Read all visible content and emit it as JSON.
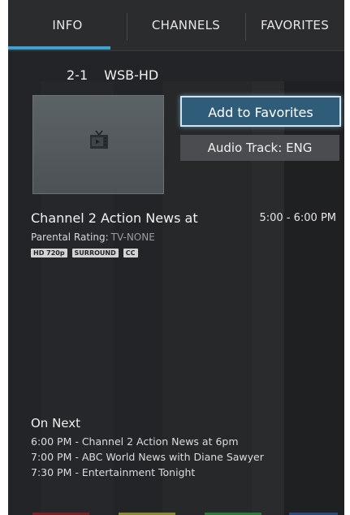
{
  "tabs": [
    {
      "label": "INFO",
      "active": true
    },
    {
      "label": "CHANNELS",
      "active": false
    },
    {
      "label": "FAVORITES",
      "active": false
    }
  ],
  "accent_color": "#3aa3d6",
  "channel": {
    "number": "2-1",
    "name": "WSB-HD",
    "thumbnail_icon": "tv-icon"
  },
  "actions": {
    "favorites_label": "Add to Favorites",
    "audio_label": "Audio Track: ENG"
  },
  "program": {
    "title": "Channel 2 Action News at",
    "time": "5:00 - 6:00 PM",
    "rating_label": "Parental Rating:",
    "rating_value": "TV-NONE",
    "badges": [
      "HD 720p",
      "SURROUND",
      "CC"
    ]
  },
  "on_next": {
    "title": "On Next",
    "items": [
      "6:00 PM - Channel 2 Action News at 6pm",
      "7:00 PM - ABC World News with Diane Sawyer",
      "7:30 PM - Entertainment Tonight"
    ]
  },
  "bottom_colors": [
    "#7a1f22",
    "#8a8a2a",
    "#2a7a3a",
    "#2a4a7a"
  ]
}
